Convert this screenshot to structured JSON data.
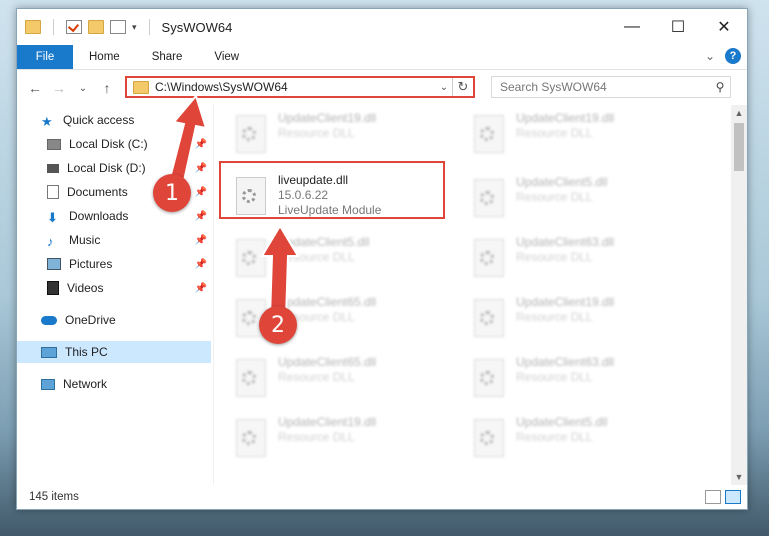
{
  "window": {
    "title": "SysWOW64"
  },
  "window_controls": {
    "minimize": "—",
    "maximize": "☐",
    "close": "✕"
  },
  "ribbon": {
    "tabs": [
      "File",
      "Home",
      "Share",
      "View"
    ],
    "expand": "⌄",
    "help": "?"
  },
  "nav_buttons": {
    "back": "←",
    "forward": "→",
    "recent": "⌄",
    "up": "↑"
  },
  "address": {
    "path": "C:\\Windows\\SysWOW64",
    "dropdown": "⌄",
    "refresh": "↻"
  },
  "search": {
    "placeholder": "Search SysWOW64",
    "icon": "⚲"
  },
  "sidebar": {
    "quick_access": "Quick access",
    "items": [
      {
        "label": "Local Disk (C:)",
        "pin": "📌"
      },
      {
        "label": "Local Disk (D:)",
        "pin": "📌"
      },
      {
        "label": "Documents",
        "pin": "📌"
      },
      {
        "label": "Downloads",
        "pin": "📌"
      },
      {
        "label": "Music",
        "pin": "📌"
      },
      {
        "label": "Pictures",
        "pin": "📌"
      },
      {
        "label": "Videos",
        "pin": "📌"
      }
    ],
    "onedrive": "OneDrive",
    "this_pc": "This PC",
    "network": "Network"
  },
  "files": {
    "highlight": {
      "name": "liveupdate.dll",
      "version": "15.0.6.22",
      "desc": "LiveUpdate Module"
    },
    "left": [
      {
        "name": "UpdateClient19.dll",
        "desc": "Resource DLL"
      },
      {
        "name": "UpdateClient5.dll",
        "desc": "Resource DLL"
      },
      {
        "name": "UpdateClient65.dll",
        "desc": "Resource DLL"
      },
      {
        "name": "UpdateClient65.dll",
        "desc": "Resource DLL"
      },
      {
        "name": "UpdateClient19.dll",
        "desc": "Resource DLL"
      }
    ],
    "right": [
      {
        "name": "UpdateClient19.dll",
        "desc": "Resource DLL"
      },
      {
        "name": "UpdateClient5.dll",
        "desc": "Resource DLL"
      },
      {
        "name": "UpdateClient63.dll",
        "desc": "Resource DLL"
      },
      {
        "name": "UpdateClient19.dll",
        "desc": "Resource DLL"
      },
      {
        "name": "UpdateClient63.dll",
        "desc": "Resource DLL"
      },
      {
        "name": "UpdateClient5.dll",
        "desc": "Resource DLL"
      }
    ]
  },
  "scrollbar": {
    "up": "▲",
    "down": "▼"
  },
  "status": {
    "count": "145 items"
  },
  "callouts": {
    "one": "1",
    "two": "2"
  },
  "colors": {
    "accent": "#1979ca",
    "annotation": "#e0453a"
  }
}
